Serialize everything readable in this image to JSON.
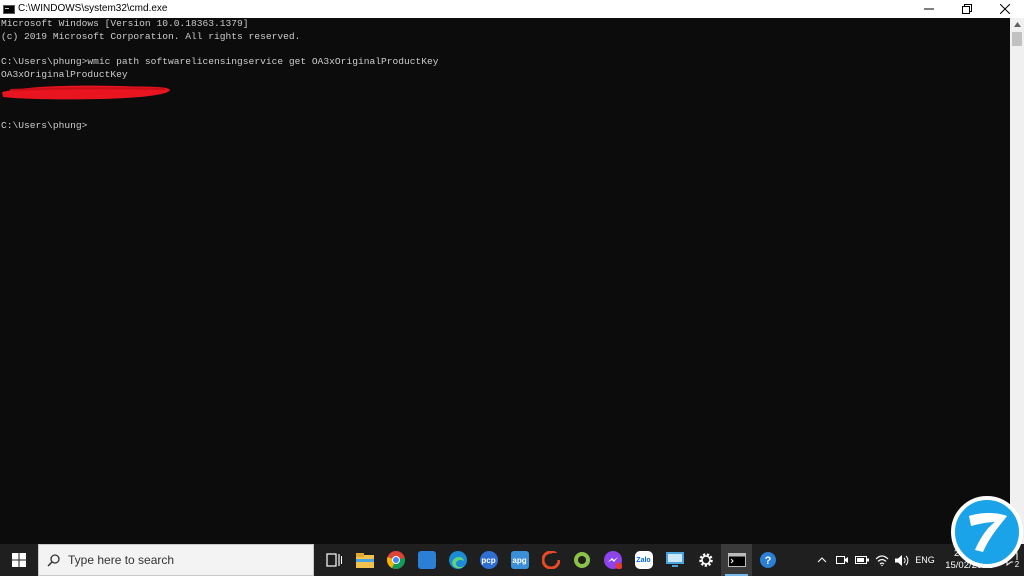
{
  "window": {
    "title": "C:\\WINDOWS\\system32\\cmd.exe",
    "controls": [
      "minimize",
      "restore",
      "close"
    ]
  },
  "console": {
    "lines": [
      "Microsoft Windows [Version 10.0.18363.1379]",
      "(c) 2019 Microsoft Corporation. All rights reserved.",
      "",
      "C:\\Users\\phung>wmic path softwarelicensingservice get OA3xOriginalProductKey",
      "OA3xOriginalProductKey",
      "",
      "",
      "",
      "C:\\Users\\phung>"
    ],
    "text_color": "#cccccc",
    "background": "#0c0c0c",
    "redaction_color": "#e8141f"
  },
  "taskbar": {
    "search_placeholder": "Type here to search",
    "pinned": [
      {
        "name": "task-view-icon",
        "label": ""
      },
      {
        "name": "file-explorer-icon",
        "label": ""
      },
      {
        "name": "chrome-icon",
        "label": ""
      },
      {
        "name": "photos-icon",
        "label": ""
      },
      {
        "name": "edge-icon",
        "label": ""
      },
      {
        "name": "pdf-app-icon",
        "label": "pcp"
      },
      {
        "name": "app-apg-icon",
        "label": "apg"
      },
      {
        "name": "ccleaner-icon",
        "label": ""
      },
      {
        "name": "green-app-icon",
        "label": ""
      },
      {
        "name": "messenger-icon",
        "label": ""
      },
      {
        "name": "zalo-icon",
        "label": "Zalo"
      },
      {
        "name": "monitor-app-icon",
        "label": ""
      },
      {
        "name": "settings-icon",
        "label": ""
      },
      {
        "name": "cmd-icon",
        "label": ""
      },
      {
        "name": "help-icon",
        "label": ""
      }
    ],
    "tray": {
      "language": "ENG",
      "time": "2:4  PM",
      "date": "15/02/2021",
      "notification_count": "2"
    }
  },
  "colors": {
    "accent": "#76b9ed",
    "logo": "#1aa3e8"
  }
}
